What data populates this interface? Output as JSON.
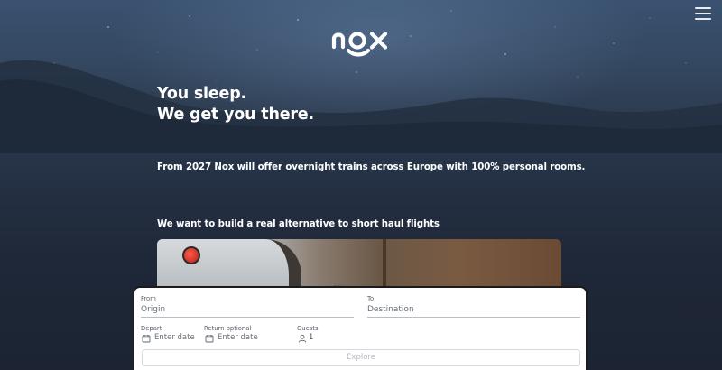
{
  "brand": {
    "logo_text": "nox"
  },
  "hero": {
    "headline_line1": "You sleep.",
    "headline_line2": "We get you there.",
    "tagline": "From 2027 Nox will offer overnight trains across Europe with 100% personal rooms.",
    "subhead": "We want to build a real alternative to short haul flights"
  },
  "media": {
    "tag": "nox"
  },
  "booking": {
    "from_label": "From",
    "from_placeholder": "Origin",
    "to_label": "To",
    "to_placeholder": "Destination",
    "depart_label": "Depart",
    "depart_placeholder": "Enter date",
    "return_label": "Return optional",
    "return_placeholder": "Enter date",
    "guests_label": "Guests",
    "guests_value": "1",
    "explore_label": "Explore"
  },
  "icons": {
    "menu": "hamburger-menu-icon",
    "calendar": "calendar-icon",
    "guests": "person-icon"
  }
}
